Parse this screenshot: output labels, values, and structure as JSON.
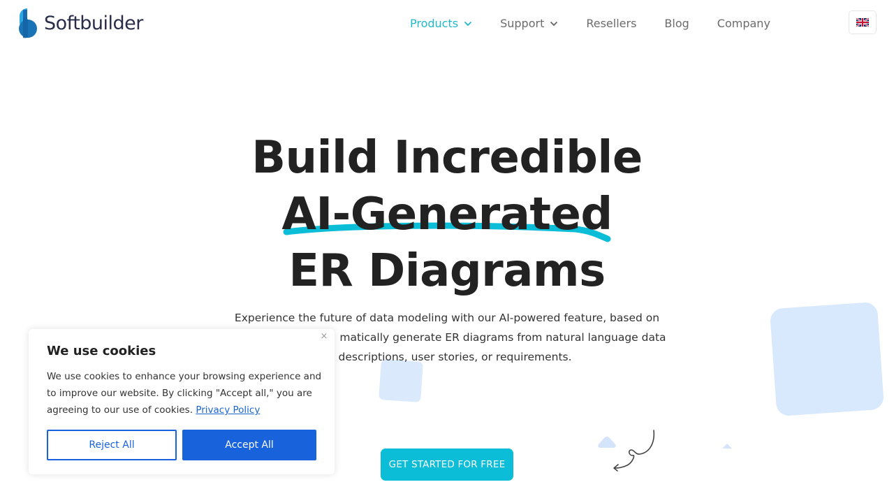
{
  "brand": {
    "name": "Softbuilder",
    "logo_colors": {
      "light": "#29a3e0",
      "dark": "#1565a8"
    }
  },
  "nav": {
    "items": [
      {
        "label": "Products",
        "has_dropdown": true,
        "active": true
      },
      {
        "label": "Support",
        "has_dropdown": true,
        "active": false
      },
      {
        "label": "Resellers",
        "has_dropdown": false,
        "active": false
      },
      {
        "label": "Blog",
        "has_dropdown": false,
        "active": false
      },
      {
        "label": "Company",
        "has_dropdown": false,
        "active": false
      }
    ],
    "language": {
      "icon": "uk-flag-icon",
      "code": "EN"
    }
  },
  "hero": {
    "title_line1": "Build Incredible",
    "title_line2": "AI-Generated",
    "title_line3": "ER Diagrams",
    "subtitle_visible_line1": "Experience the future of data modeling with our AI-powered feature, based on",
    "subtitle_visible_line2": "matically generate ER diagrams from natural language data",
    "subtitle_visible_line3": "lel descriptions, user stories, or requirements.",
    "cta_label": "GET STARTED FOR FREE",
    "accent_color": "#0bbdd6"
  },
  "cookie_banner": {
    "title": "We use cookies",
    "text": "We use cookies to enhance your browsing experience and to improve our website. By clicking \"Accept all,\" you are agreeing to our use of cookies.",
    "link_label": "Privacy Policy",
    "reject_label": "Reject All",
    "accept_label": "Accept All",
    "close_icon": "×",
    "primary_color": "#1863dc"
  }
}
